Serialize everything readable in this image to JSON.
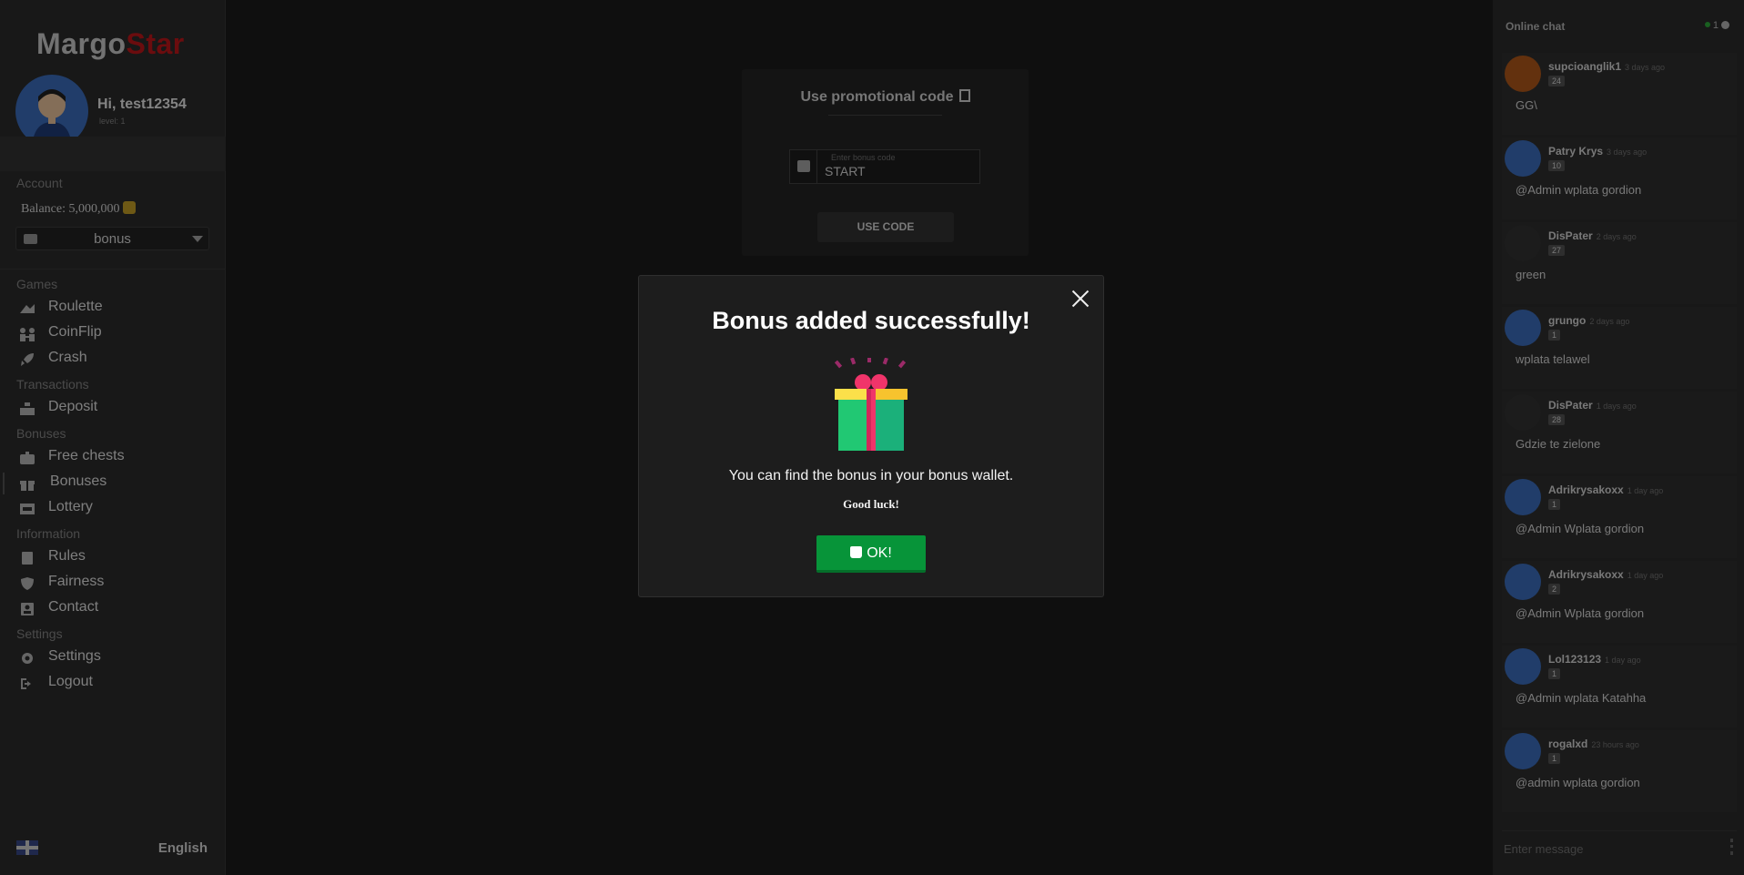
{
  "logo": {
    "part1": "Margo",
    "part2": "Star"
  },
  "user": {
    "greeting": "Hi, test12354",
    "level": "level: 1"
  },
  "account": {
    "label": "Account",
    "balance": "Balance: 5,000,000",
    "wallet_selected": "bonus"
  },
  "nav": {
    "games_label": "Games",
    "roulette": "Roulette",
    "coinflip": "CoinFlip",
    "crash": "Crash",
    "transactions_label": "Transactions",
    "deposit": "Deposit",
    "bonuses_label": "Bonuses",
    "free_chests": "Free chests",
    "bonuses": "Bonuses",
    "lottery": "Lottery",
    "information_label": "Information",
    "rules": "Rules",
    "fairness": "Fairness",
    "contact": "Contact",
    "settings_label": "Settings",
    "settings": "Settings",
    "logout": "Logout"
  },
  "language": "English",
  "promo": {
    "title": "Use promotional code",
    "placeholder": "Enter bonus code",
    "value": "START",
    "button": "USE CODE"
  },
  "chat": {
    "title": "Online chat",
    "online_count": "1",
    "input_placeholder": "Enter message",
    "messages": [
      {
        "user": "supcioanglik1",
        "time": "3 days ago",
        "level": "24",
        "text": "GG\\"
      },
      {
        "user": "Patry Krys",
        "time": "3 days ago",
        "level": "10",
        "text": "@Admin wplata gordion"
      },
      {
        "user": "DisPater",
        "time": "2 days ago",
        "level": "27",
        "text": "green"
      },
      {
        "user": "grungo",
        "time": "2 days ago",
        "level": "1",
        "text": "wplata telawel"
      },
      {
        "user": "DisPater",
        "time": "1 days ago",
        "level": "28",
        "text": "Gdzie te zielone"
      },
      {
        "user": "Adrikrysakoxx",
        "time": "1 day ago",
        "level": "1",
        "text": "@Admin Wplata gordion"
      },
      {
        "user": "Adrikrysakoxx",
        "time": "1 day ago",
        "level": "2",
        "text": "@Admin Wplata gordion"
      },
      {
        "user": "Lol123123",
        "time": "1 day ago",
        "level": "1",
        "text": "@Admin wplata Katahha"
      },
      {
        "user": "rogalxd",
        "time": "23 hours ago",
        "level": "1",
        "text": "@admin wplata gordion"
      }
    ]
  },
  "modal": {
    "title": "Bonus added successfully!",
    "text": "You can find the bonus in your bonus wallet.",
    "subtext": "Good luck!",
    "ok_label": "OK!"
  },
  "colors": {
    "brand_red": "#c3171b",
    "ok_green": "#079439",
    "online_green": "#2eae3b"
  }
}
